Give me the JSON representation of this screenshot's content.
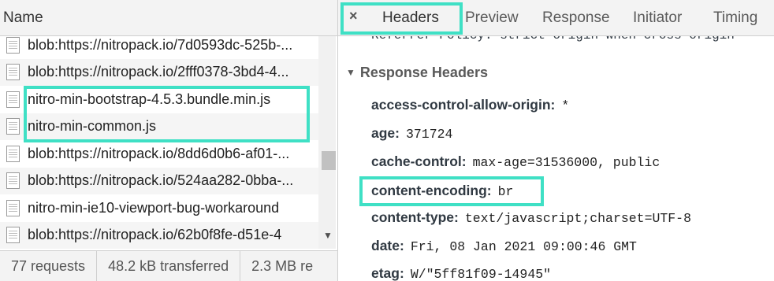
{
  "left": {
    "header": "Name",
    "rows": [
      "blob:https://nitropack.io/7d0593dc-525b-...",
      "blob:https://nitropack.io/2fff0378-3bd4-4...",
      "nitro-min-bootstrap-4.5.3.bundle.min.js",
      "nitro-min-common.js",
      "blob:https://nitropack.io/8dd6d0b6-af01-...",
      "blob:https://nitropack.io/524aa282-0bba-...",
      "nitro-min-ie10-viewport-bug-workaround",
      "blob:https://nitropack.io/62b0f8fe-d51e-4"
    ],
    "status": [
      "77 requests",
      "48.2 kB transferred",
      "2.3 MB re"
    ]
  },
  "right": {
    "close": "×",
    "tabs": [
      "Headers",
      "Preview",
      "Response",
      "Initiator",
      "Timing"
    ],
    "cut_line": "Referrer-Policy: strict-origin-when-cross-origin",
    "section_title": "Response Headers",
    "headers": [
      {
        "k": "access-control-allow-origin:",
        "v": "*"
      },
      {
        "k": "age:",
        "v": "371724"
      },
      {
        "k": "cache-control:",
        "v": "max-age=31536000, public"
      },
      {
        "k": "content-encoding:",
        "v": "br"
      },
      {
        "k": "content-type:",
        "v": "text/javascript;charset=UTF-8"
      },
      {
        "k": "date:",
        "v": "Fri, 08 Jan 2021 09:00:46 GMT"
      },
      {
        "k": "etag:",
        "v": "W/\"5ff81f09-14945\""
      }
    ]
  },
  "colors": {
    "highlight": "#3fe0c5"
  }
}
